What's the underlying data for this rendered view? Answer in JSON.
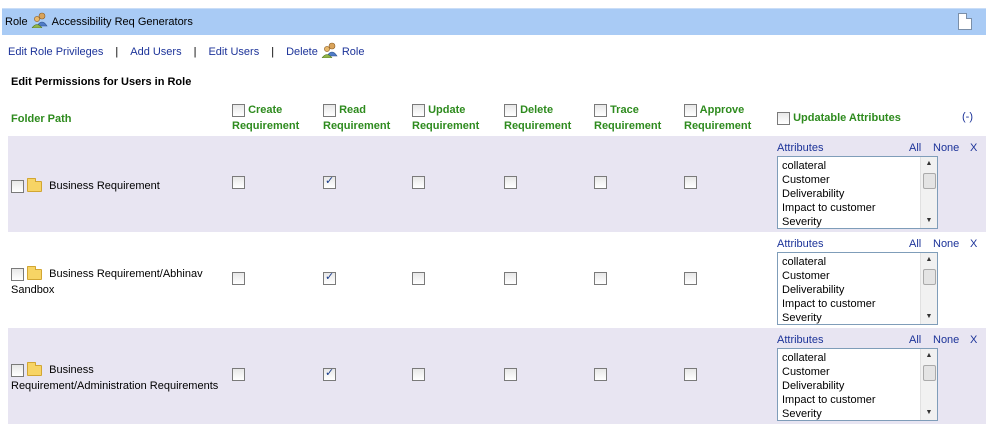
{
  "title": {
    "prefix": "Role",
    "name": "Accessibility Req Generators"
  },
  "links": {
    "edit_privileges": "Edit Role Privileges",
    "add_users": "Add Users",
    "edit_users": "Edit Users",
    "delete": "Delete",
    "delete_suffix": "Role",
    "separator": "|"
  },
  "section_title": "Edit Permissions for Users in Role",
  "headers": {
    "folder_path": "Folder Path",
    "create": [
      "Create",
      "Requirement"
    ],
    "read": [
      "Read",
      "Requirement"
    ],
    "update": [
      "Update",
      "Requirement"
    ],
    "delete": [
      "Delete",
      "Requirement"
    ],
    "trace": [
      "Trace",
      "Requirement"
    ],
    "approve": [
      "Approve",
      "Requirement"
    ],
    "updatable_attributes": "Updatable Attributes",
    "collapse": "(-)"
  },
  "attr_controls": {
    "label": "Attributes",
    "all": "All",
    "none": "None",
    "x": "X"
  },
  "rows": [
    {
      "path_line1": "Business Requirement",
      "path_line2": "",
      "create": false,
      "read": true,
      "update": false,
      "delete": false,
      "trace": false,
      "approve": false,
      "attributes": [
        "collateral",
        "Customer",
        "Deliverability",
        "Impact to customer",
        "Severity"
      ]
    },
    {
      "path_line1": "Business Requirement/Abhinav",
      "path_line2": "Sandbox",
      "create": false,
      "read": true,
      "update": false,
      "delete": false,
      "trace": false,
      "approve": false,
      "attributes": [
        "collateral",
        "Customer",
        "Deliverability",
        "Impact to customer",
        "Severity"
      ]
    },
    {
      "path_line1": "Business",
      "path_line2": "Requirement/Administration Requirements",
      "create": false,
      "read": true,
      "update": false,
      "delete": false,
      "trace": false,
      "approve": false,
      "attributes": [
        "collateral",
        "Customer",
        "Deliverability",
        "Impact to customer",
        "Severity"
      ]
    }
  ],
  "colors": {
    "titlebar": "#a9cbf5",
    "row_shade": "#e8e5f2",
    "header_green": "#2e8b1e",
    "link_blue": "#1c3399"
  },
  "icons": {
    "role": "role-users-icon",
    "document": "document-icon",
    "folder": "folder-icon"
  }
}
